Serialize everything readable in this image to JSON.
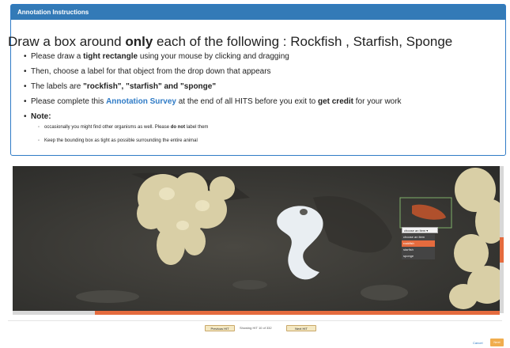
{
  "panel": {
    "title": "Annotation Instructions",
    "headline": {
      "pre": "Draw a box around ",
      "bold": "only",
      "post": " each of the following : Rockfish , Starfish, Sponge"
    },
    "bullets": {
      "b1_pre": "Please draw a ",
      "b1_bold": "tight rectangle",
      "b1_post": " using your mouse by clicking and dragging",
      "b2": "Then, choose a label for that object from the drop down that appears",
      "b3_pre": "The labels are ",
      "b3_bold": "\"rockfish\", \"starfish\" and \"sponge\"",
      "b4_pre": "Please complete this ",
      "b4_link": "Annotation Survey",
      "b4_mid": " at the end of all HITS before you exit to ",
      "b4_bold": "get credit",
      "b4_post": " for your work",
      "b5_bold": "Note:"
    },
    "notes": {
      "n1_pre": "occasionally you might find other organisms as well. Please ",
      "n1_bold": "do not",
      "n1_post": " label them",
      "n2": "Keep the bounding box as tight as possible surrounding the entire animal"
    }
  },
  "annotator": {
    "select_value": "choose an item",
    "select_arrow": "▾",
    "options": [
      "choose an item",
      "rockfish",
      "starfish",
      "sponge"
    ],
    "highlighted_option": "rockfish"
  },
  "pager": {
    "prev_label": "Previous HIT",
    "status": "Showing HIT 10 of 332",
    "next_label": "Next HIT"
  },
  "footer": {
    "cancel_label": "Cancel",
    "next_label": "Next"
  },
  "colors": {
    "accent": "#337ab7",
    "orange": "#e56b3e",
    "button_warning": "#f0ad4e"
  }
}
